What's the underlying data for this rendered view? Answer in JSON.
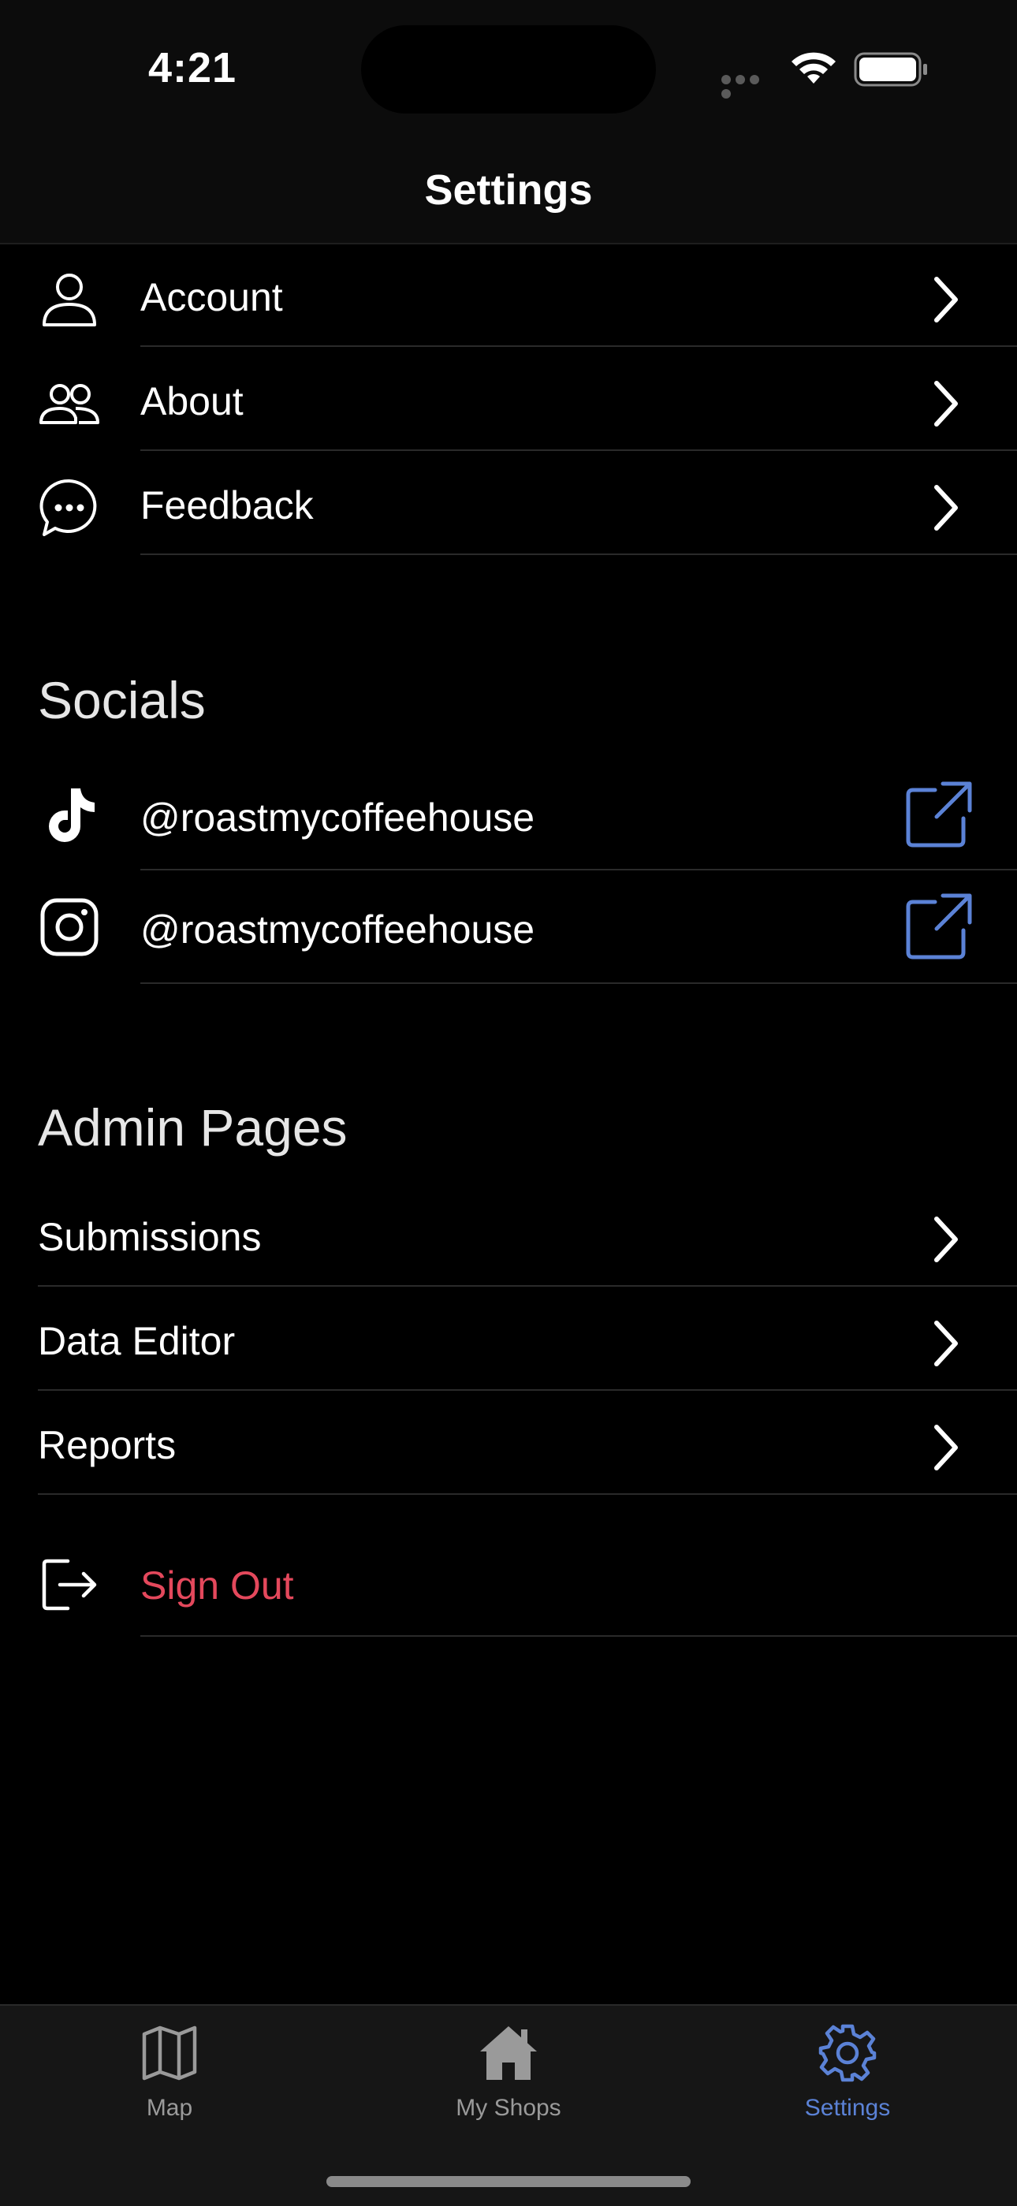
{
  "status_bar": {
    "time": "4:21",
    "icons": [
      "cellular-signal-icon",
      "wifi-icon",
      "battery-icon"
    ]
  },
  "nav": {
    "title": "Settings"
  },
  "main_items": [
    {
      "label": "Account",
      "icon": "person-icon"
    },
    {
      "label": "About",
      "icon": "people-icon"
    },
    {
      "label": "Feedback",
      "icon": "chat-bubble-icon"
    }
  ],
  "socials": {
    "header": "Socials",
    "items": [
      {
        "label": "@roastmycoffeehouse",
        "icon": "tiktok-icon",
        "action_icon": "external-link-icon"
      },
      {
        "label": "@roastmycoffeehouse",
        "icon": "instagram-icon",
        "action_icon": "external-link-icon"
      }
    ]
  },
  "admin": {
    "header": "Admin Pages",
    "items": [
      {
        "label": "Submissions"
      },
      {
        "label": "Data Editor"
      },
      {
        "label": "Reports"
      }
    ]
  },
  "sign_out": {
    "label": "Sign Out",
    "icon": "sign-out-icon",
    "color": "#e4485c"
  },
  "tab_bar": {
    "tabs": [
      {
        "label": "Map",
        "icon": "map-icon",
        "active": false
      },
      {
        "label": "My Shops",
        "icon": "house-icon",
        "active": false
      },
      {
        "label": "Settings",
        "icon": "gear-icon",
        "active": true
      }
    ],
    "accent": "#5b82d6"
  }
}
